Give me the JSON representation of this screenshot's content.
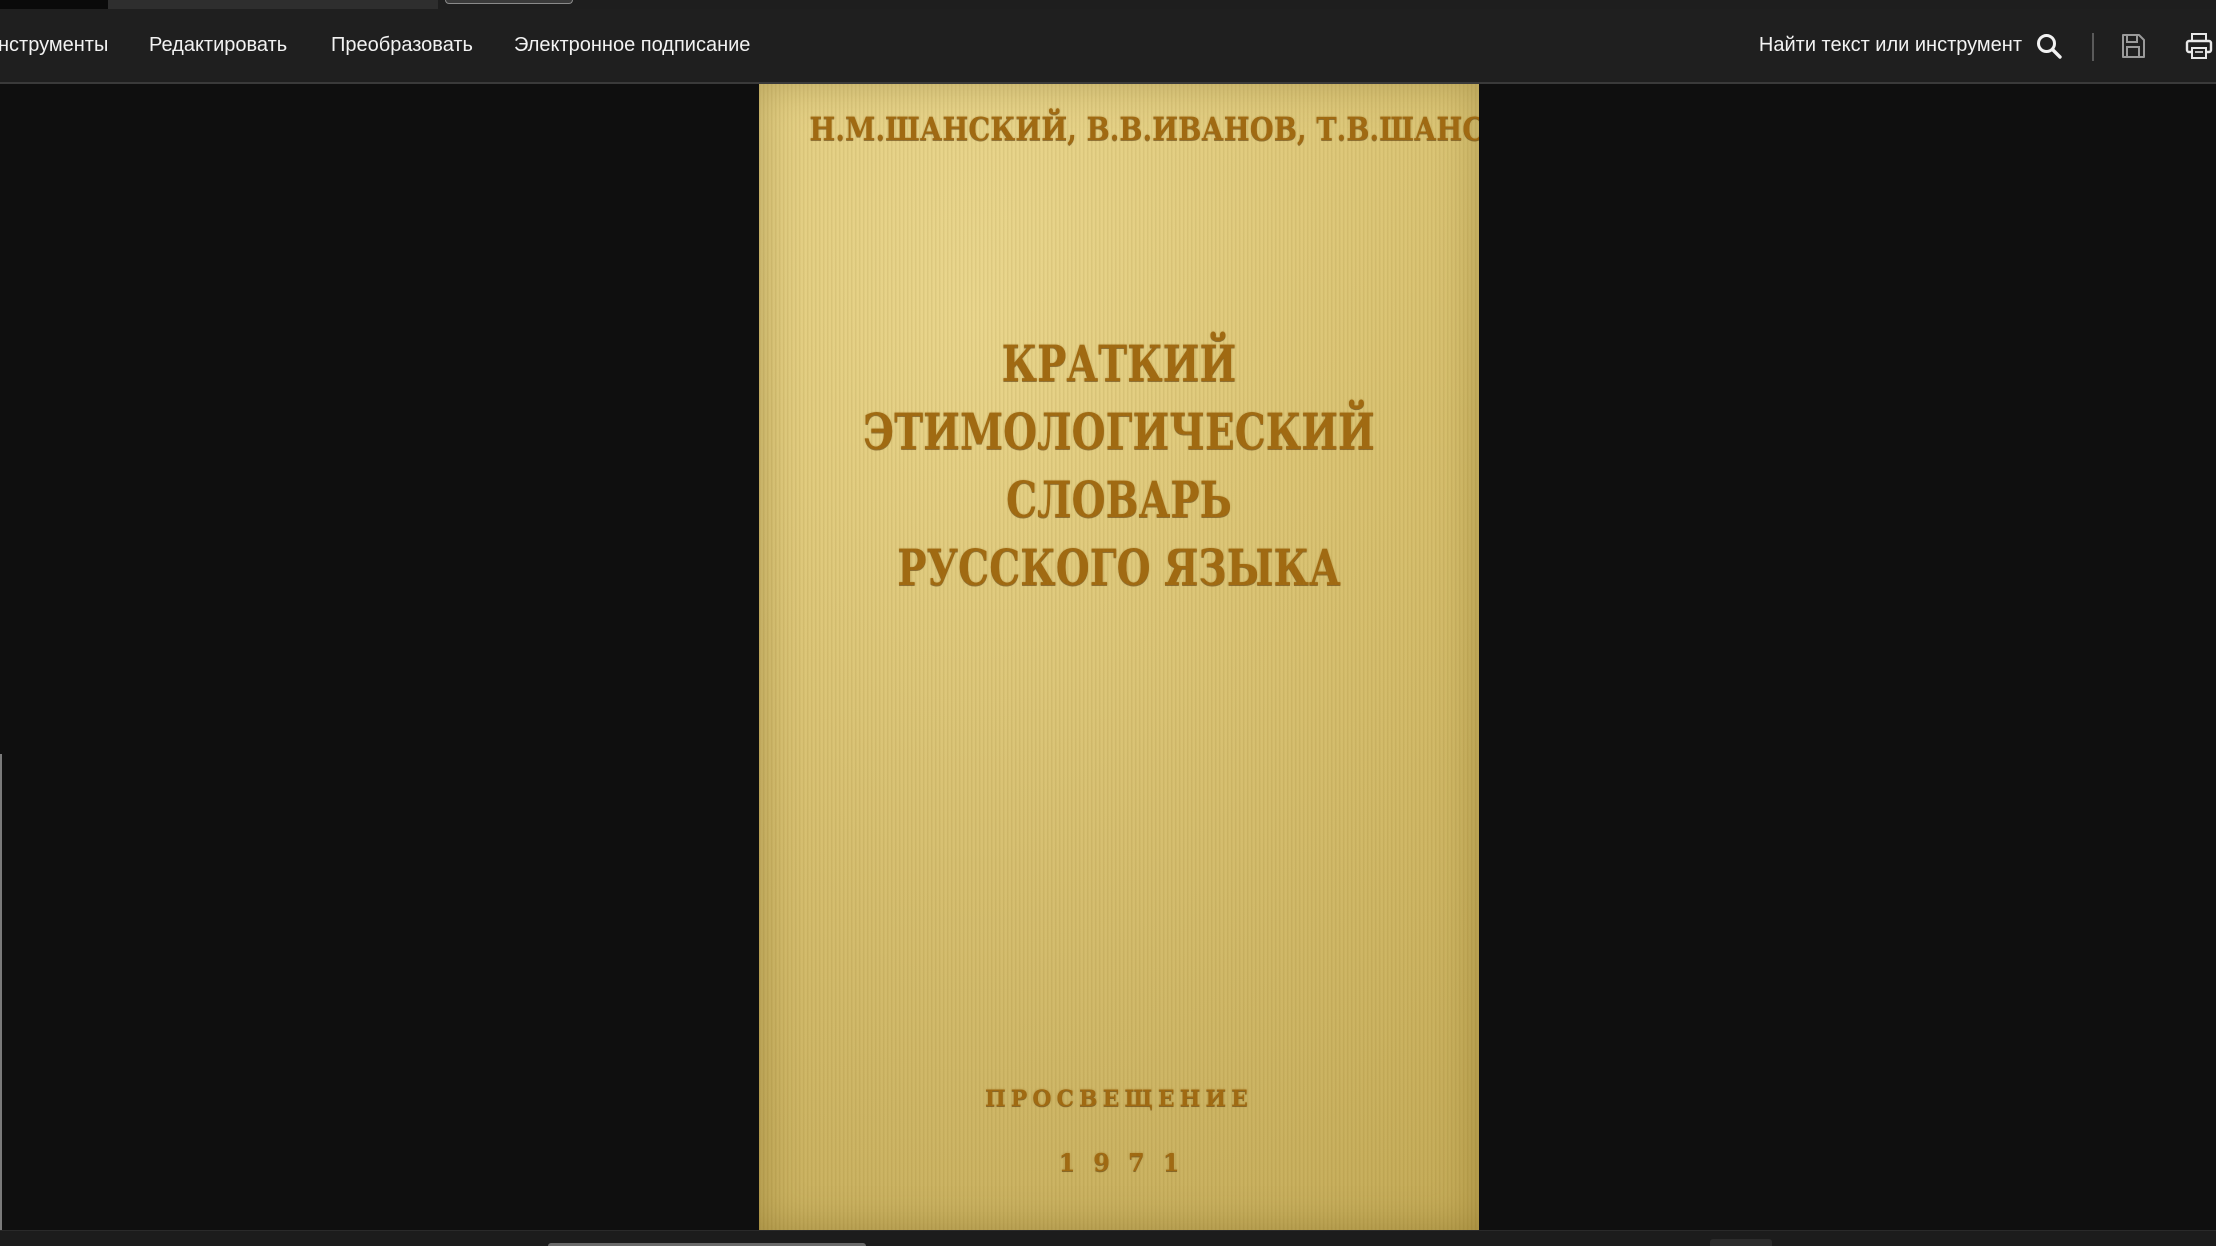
{
  "toolbar": {
    "menu": {
      "tools": "нструменты",
      "edit": "Редактировать",
      "convert": "Преобразовать",
      "sign": "Электронное подписание"
    },
    "find_placeholder": "Найти текст или инструмент",
    "icons": {
      "search": "search-icon",
      "save": "save-icon",
      "print": "print-icon"
    }
  },
  "document": {
    "cover": {
      "authors": "Н.М.ШАНСКИЙ, В.В.ИВАНОВ, Т.В.ШАНСКАЯ",
      "title_lines": [
        "КРАТКИЙ",
        "ЭТИМОЛОГИЧЕСКИЙ",
        "СЛОВАРЬ",
        "РУССКОГО ЯЗЫКА"
      ],
      "publisher": "ПРОСВЕЩЕНИЕ",
      "year": "1971"
    }
  },
  "colors": {
    "toolbar_bg": "#1f1f1f",
    "viewport_bg": "#0f0f0f",
    "cover_bg": "#dcc575",
    "cover_text": "#a06a12"
  }
}
